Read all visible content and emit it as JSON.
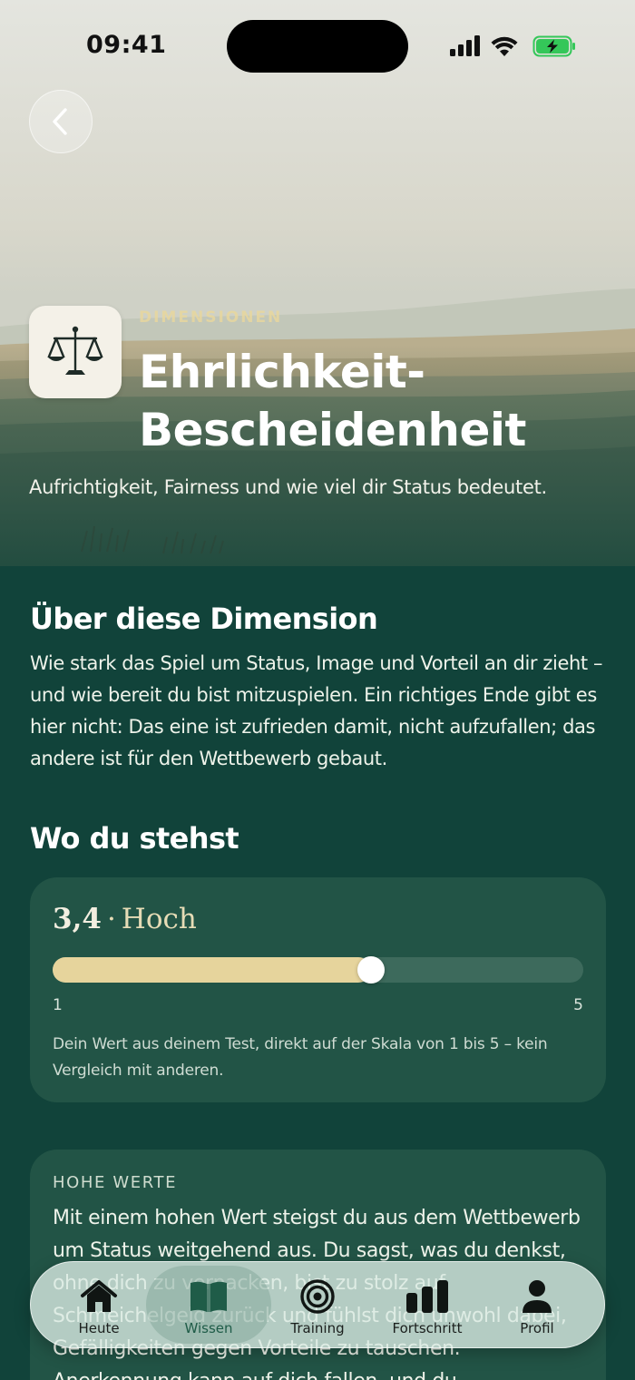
{
  "status_bar": {
    "time": "09:41"
  },
  "header": {
    "eyebrow": "DIMENSIONEN",
    "title": "Ehrlichkeit-Bescheidenheit",
    "subtitle": "Aufrichtigkeit, Fairness und wie viel dir Status bedeutet.",
    "icon": "scales-icon"
  },
  "about": {
    "heading": "Über diese Dimension",
    "text": "Wie stark das Spiel um Status, Image und Vorteil an dir zieht – und wie bereit du bist mitzuspielen. Ein richtiges Ende gibt es hier nicht: Das eine ist zufrieden damit, nicht aufzufallen; das andere ist für den Wettbewerb gebaut."
  },
  "position": {
    "heading": "Wo du stehst",
    "score": "3,4",
    "separator": "·",
    "level": "Hoch",
    "score_value": 3.4,
    "scale_min": "1",
    "scale_max": "5",
    "note": "Dein Wert aus deinem Test, direkt auf der Skala von 1 bis 5 – kein Vergleich mit anderen."
  },
  "high_values": {
    "label": "HOHE WERTE",
    "text": "Mit einem hohen Wert steigst du aus dem Wettbewerb um Status weitgehend aus. Du sagst, was du denkst, ohne dich zu verpacken, bist zu stolz auf Schmeichelgeld zurück und fühlst dich unwohl dabei, Gefälligkeiten gegen Vorteile zu tauschen. Anerkennung kann auf dich fallen, und du"
  },
  "tabbar": {
    "active": "Wissen",
    "tabs": [
      {
        "label": "Heute",
        "icon": "home-icon"
      },
      {
        "label": "Wissen",
        "icon": "book-icon"
      },
      {
        "label": "Training",
        "icon": "target-icon"
      },
      {
        "label": "Fortschritt",
        "icon": "bar-chart-icon"
      },
      {
        "label": "Profil",
        "icon": "person-icon"
      }
    ]
  },
  "colors": {
    "background": "#11433a",
    "card": "#225446",
    "accent": "#e6d49c",
    "battery": "#34c759"
  }
}
